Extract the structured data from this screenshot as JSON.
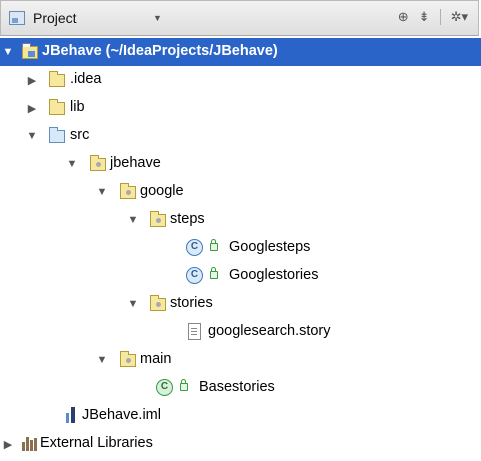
{
  "header": {
    "title": "Project",
    "icons": [
      "target-icon",
      "collapse-icon",
      "gear-icon"
    ]
  },
  "tree": {
    "root_label": "JBehave (~/IdeaProjects/JBehave)",
    "idea_label": ".idea",
    "lib_label": "lib",
    "src_label": "src",
    "jbehave_label": "jbehave",
    "google_label": "google",
    "steps_label": "steps",
    "googlesteps_label": "Googlesteps",
    "googlestories_label": "Googlestories",
    "stories_label": "stories",
    "story_file_label": "googlesearch.story",
    "main_label": "main",
    "basestories_label": "Basestories",
    "iml_label": "JBehave.iml",
    "external_label": "External Libraries"
  },
  "colors": {
    "selection": "#2a64c8",
    "header_bg": "#e6e6e6"
  }
}
